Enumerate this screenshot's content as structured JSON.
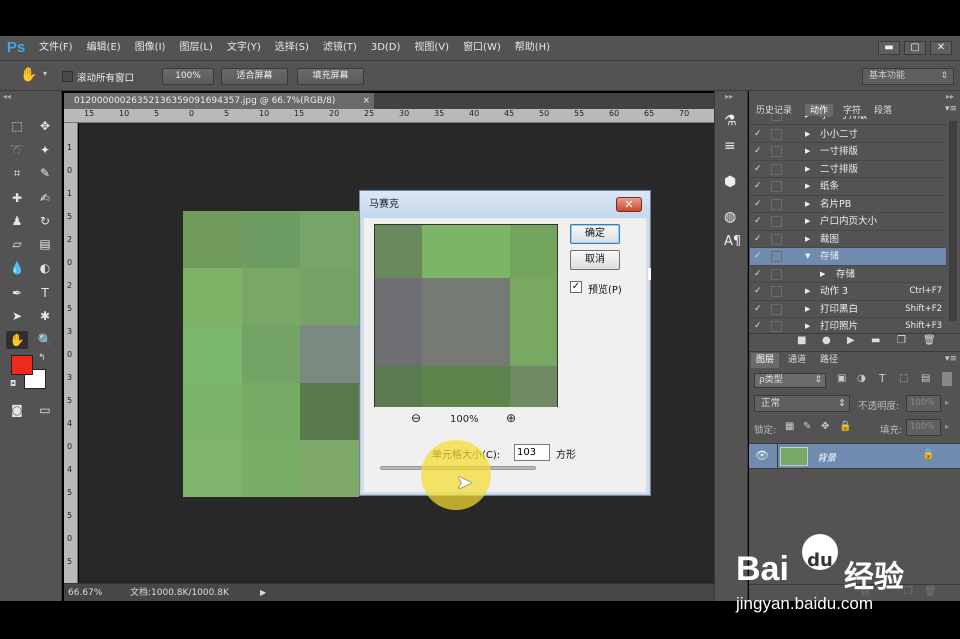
{
  "app": {
    "logo": "Ps"
  },
  "menu": [
    "文件(F)",
    "编辑(E)",
    "图像(I)",
    "图层(L)",
    "文字(Y)",
    "选择(S)",
    "滤镜(T)",
    "3D(D)",
    "视图(V)",
    "窗口(W)",
    "帮助(H)"
  ],
  "window_controls": {
    "minimize": "▬",
    "maximize": "▢",
    "close": "✕"
  },
  "options": {
    "scroll_all_label": "滚动所有窗口",
    "zoom_100": "100%",
    "fit_screen": "适合屏幕",
    "fill_screen": "填充屏幕",
    "workspace": "基本功能"
  },
  "document": {
    "tab_title": "01200000026352136359091694357.jpg @ 66.7%(RGB/8)",
    "tab_close": "×",
    "zoom": "66.67%",
    "doc_info": "文档:1000.8K/1000.8K",
    "ruler_top": [
      "15",
      "10",
      "5",
      "0",
      "5",
      "10",
      "15",
      "20",
      "25",
      "30",
      "35",
      "40",
      "45",
      "50",
      "55",
      "60",
      "65",
      "70"
    ],
    "ruler_left": [
      "1",
      "0",
      "1",
      "5",
      "2",
      "0",
      "2",
      "5",
      "3",
      "0",
      "3",
      "5",
      "4",
      "0",
      "4",
      "5",
      "5",
      "0",
      "5"
    ],
    "mosaic": [
      "#6f9a5a",
      "#6e9c65",
      "#76a567",
      "#7eb267",
      "#78a766",
      "#77a265",
      "#7ab76a",
      "#73a465",
      "#7a8a80",
      "#7cb46a",
      "#76ac65",
      "#5a7a4e",
      "#7fb46a",
      "#77ad65",
      "#7fa96a"
    ]
  },
  "panels": {
    "history_tabs": [
      "历史记录",
      "动作",
      "字符",
      "段落"
    ],
    "actions": [
      {
        "name": "小一寸排版",
        "shortcut": "",
        "partial": true
      },
      {
        "name": "小小二寸",
        "shortcut": ""
      },
      {
        "name": "一寸排版",
        "shortcut": ""
      },
      {
        "name": "二寸排版",
        "shortcut": ""
      },
      {
        "name": "纸条",
        "shortcut": ""
      },
      {
        "name": "名片PB",
        "shortcut": ""
      },
      {
        "name": "户口内页大小",
        "shortcut": ""
      },
      {
        "name": "裁图",
        "shortcut": ""
      },
      {
        "name": "存储",
        "shortcut": "",
        "expanded": true,
        "selected": true
      },
      {
        "name": "存储",
        "shortcut": "",
        "child": true
      },
      {
        "name": "动作 3",
        "shortcut": "Ctrl+F7"
      },
      {
        "name": "打印黑白",
        "shortcut": "Shift+F2"
      },
      {
        "name": "打印照片",
        "shortcut": "Shift+F3"
      }
    ],
    "layers_tabs": [
      "图层",
      "通道",
      "路径"
    ],
    "kind_filter": "ρ类型",
    "blend_mode": "正常",
    "opacity_label": "不透明度:",
    "opacity_value": "100%",
    "lock_label": "锁定:",
    "fill_label": "填充:",
    "fill_value": "100%",
    "layer_name": "背景"
  },
  "dialog": {
    "title": "马赛克",
    "ok": "确定",
    "cancel": "取消",
    "preview_label": "预览(P)",
    "preview_checked": "✓",
    "zoom_level": "100%",
    "cell_size_label": "单元格大小(C):",
    "cell_size_value": "103",
    "unit": "方形",
    "preview_cells": [
      "#6a8a5e",
      "#7db567",
      "#73a55f",
      "#6d6f72",
      "#757a72",
      "#79a863",
      "#5a7a4f",
      "#5d844a",
      "#6f8a63"
    ]
  },
  "watermark": {
    "brand_a": "Bai",
    "brand_b": "du",
    "brand_c": "经验",
    "url": "jingyan.baidu.com"
  },
  "colors": {
    "foreground": "#f0281e",
    "background": "#ffffff",
    "selection": "#6f8baf"
  }
}
